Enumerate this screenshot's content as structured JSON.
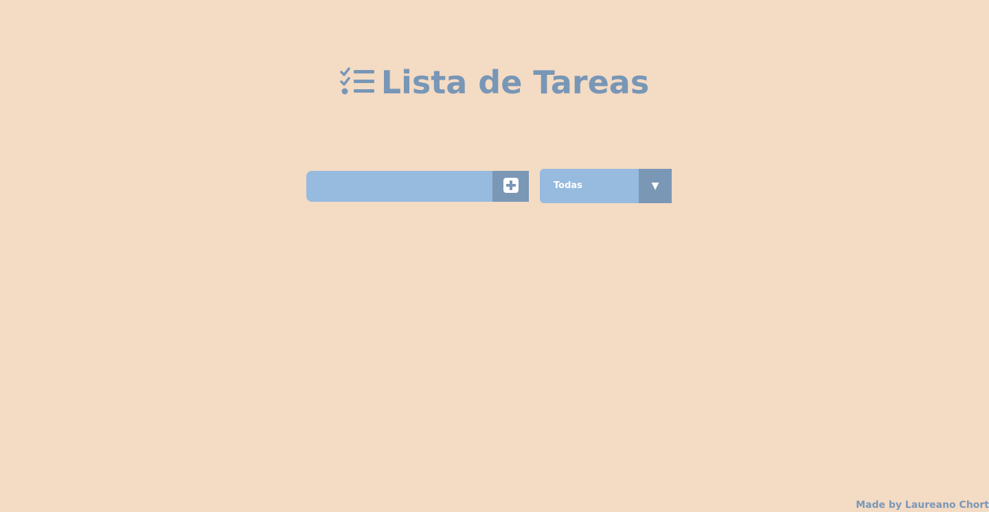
{
  "header": {
    "title": "Lista de Tareas",
    "icon": "task-list-icon"
  },
  "form": {
    "input_value": "",
    "input_placeholder": "",
    "add_icon": "plus-square-icon",
    "filter_selected": "Todas",
    "filter_arrow_icon": "caret-down-icon"
  },
  "footer": {
    "credit": "Made by Laureano Chort"
  },
  "colors": {
    "background": "#f3dbc4",
    "accent": "#7896b6",
    "field": "#97badf",
    "field_dark": "#7b97b6",
    "text_light": "#ffffff"
  }
}
